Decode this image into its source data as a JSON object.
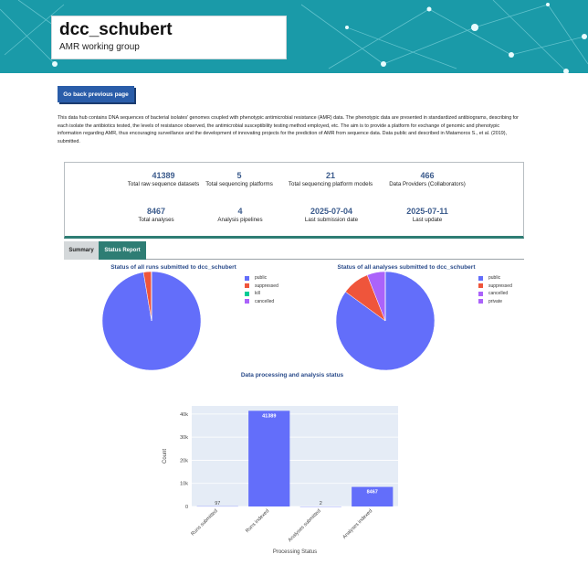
{
  "header": {
    "title": "dcc_schubert",
    "subtitle": "AMR working group"
  },
  "nav": {
    "back_label": "Go back previous page"
  },
  "description": "This data hub contains DNA sequences of bacterial isolates' genomes coupled with phenotypic antimicrobial resistance (AMR) data. The phenotypic data are presented in standardized antibiograms, describing for each isolate the antibiotics tested, the levels of resistance observed, the antimicrobial susceptibility testing method employed, etc. The aim is to provide a platform for exchange of genomic and phenotypic information regarding AMR, thus encouraging surveillance and the development of innovating projects for the prediction of AMR from sequence data. Data public and described in Matamoros S., et al. (2019), submitted.",
  "stats": [
    {
      "value": "41389",
      "label": "Total raw sequence datasets"
    },
    {
      "value": "5",
      "label": "Total sequencing platforms"
    },
    {
      "value": "21",
      "label": "Total sequencing platform models"
    },
    {
      "value": "466",
      "label": "Data Providers (Collaborators)"
    },
    {
      "value": "8467",
      "label": "Total analyses"
    },
    {
      "value": "4",
      "label": "Analysis pipelines"
    },
    {
      "value": "2025-07-04",
      "label": "Last submission date"
    },
    {
      "value": "2025-07-11",
      "label": "Last update"
    }
  ],
  "tabs": [
    {
      "label": "Summary"
    },
    {
      "label": "Status Report"
    }
  ],
  "colors": {
    "public": "#636efa",
    "suppressed": "#ef553b",
    "kill": "#00cc96",
    "cancelled": "#ab63fa",
    "private": "#ab63fa",
    "accent": "#2e7d74",
    "button": "#2a5da9"
  },
  "chart_data": [
    {
      "type": "pie",
      "title": "Status of all runs submitted to dcc_schubert",
      "labels": [
        "public",
        "suppressed",
        "kill",
        "cancelled"
      ],
      "values": [
        40300,
        1050,
        20,
        19
      ]
    },
    {
      "type": "pie",
      "title": "Status of all analyses submitted to dcc_schubert",
      "labels": [
        "public",
        "suppressed",
        "cancelled",
        "private"
      ],
      "values": [
        7200,
        760,
        505,
        2
      ]
    },
    {
      "type": "bar",
      "title": "Data processing and analysis status",
      "xlabel": "Processing Status",
      "ylabel": "Count",
      "categories": [
        "Runs submitted",
        "Runs indexed",
        "Analyses submitted",
        "Analyses indexed"
      ],
      "values": [
        97,
        41389,
        2,
        8467
      ],
      "data_labels": [
        "97",
        "41389",
        "2",
        "8467"
      ],
      "yticks": [
        0,
        10000,
        20000,
        30000,
        40000
      ],
      "ytick_labels": [
        "0",
        "10k",
        "20k",
        "30k",
        "40k"
      ],
      "ylim": [
        0,
        43500
      ],
      "grid": true
    }
  ]
}
